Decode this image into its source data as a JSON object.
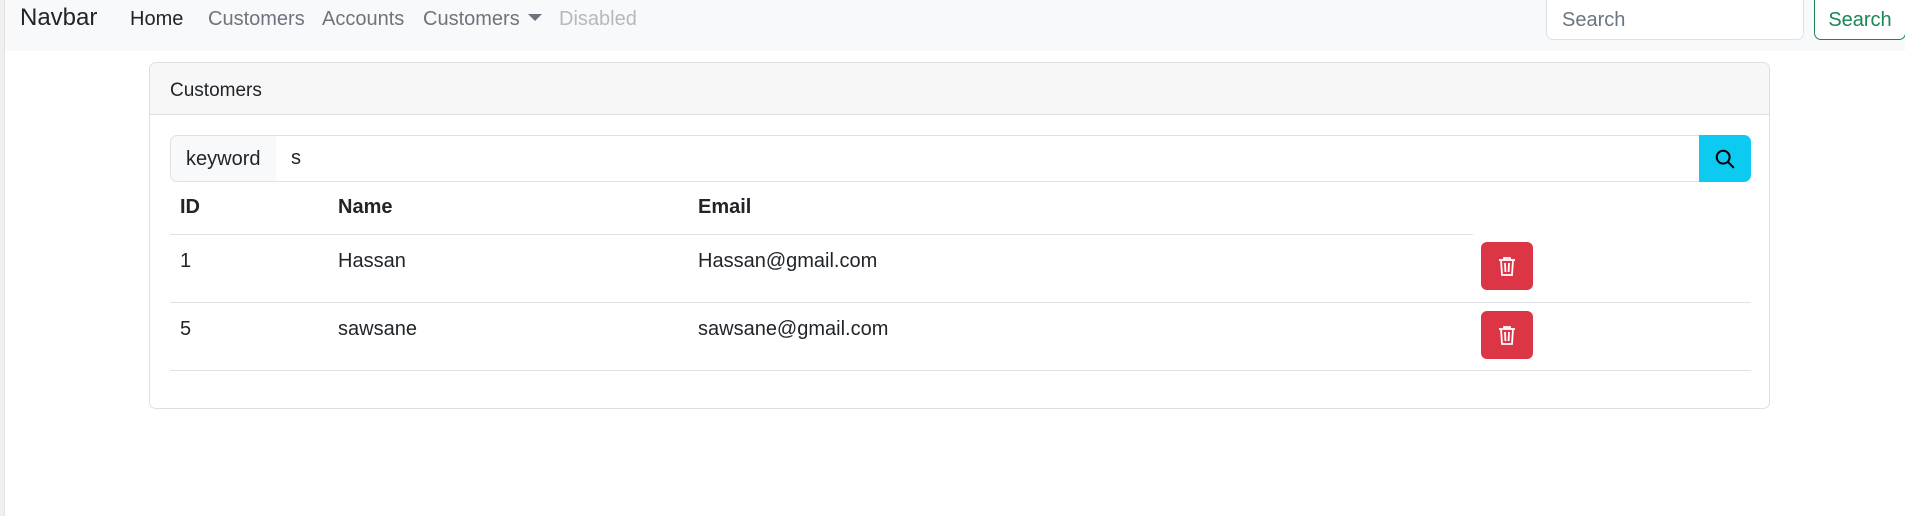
{
  "navbar": {
    "brand": "Navbar",
    "items": [
      {
        "label": "Home",
        "state": "active"
      },
      {
        "label": "Customers",
        "state": "normal"
      },
      {
        "label": "Accounts",
        "state": "normal"
      },
      {
        "label": "Customers",
        "state": "dropdown"
      },
      {
        "label": "Disabled",
        "state": "disabled"
      }
    ],
    "search_placeholder": "Search",
    "search_button": "Search"
  },
  "card": {
    "title": "Customers",
    "search": {
      "label": "keyword",
      "value": "s",
      "button_icon": "search-icon"
    },
    "table": {
      "columns": [
        "ID",
        "Name",
        "Email",
        ""
      ],
      "rows": [
        {
          "id": "1",
          "name": "Hassan",
          "email": "Hassan@gmail.com",
          "action_icon": "trash-icon"
        },
        {
          "id": "5",
          "name": "sawsane",
          "email": "sawsane@gmail.com",
          "action_icon": "trash-icon"
        }
      ]
    }
  },
  "colors": {
    "navbar_bg": "#f8f9fa",
    "search_outline": "#198754",
    "info_button": "#0dcaf0",
    "danger_button": "#dc3545"
  }
}
